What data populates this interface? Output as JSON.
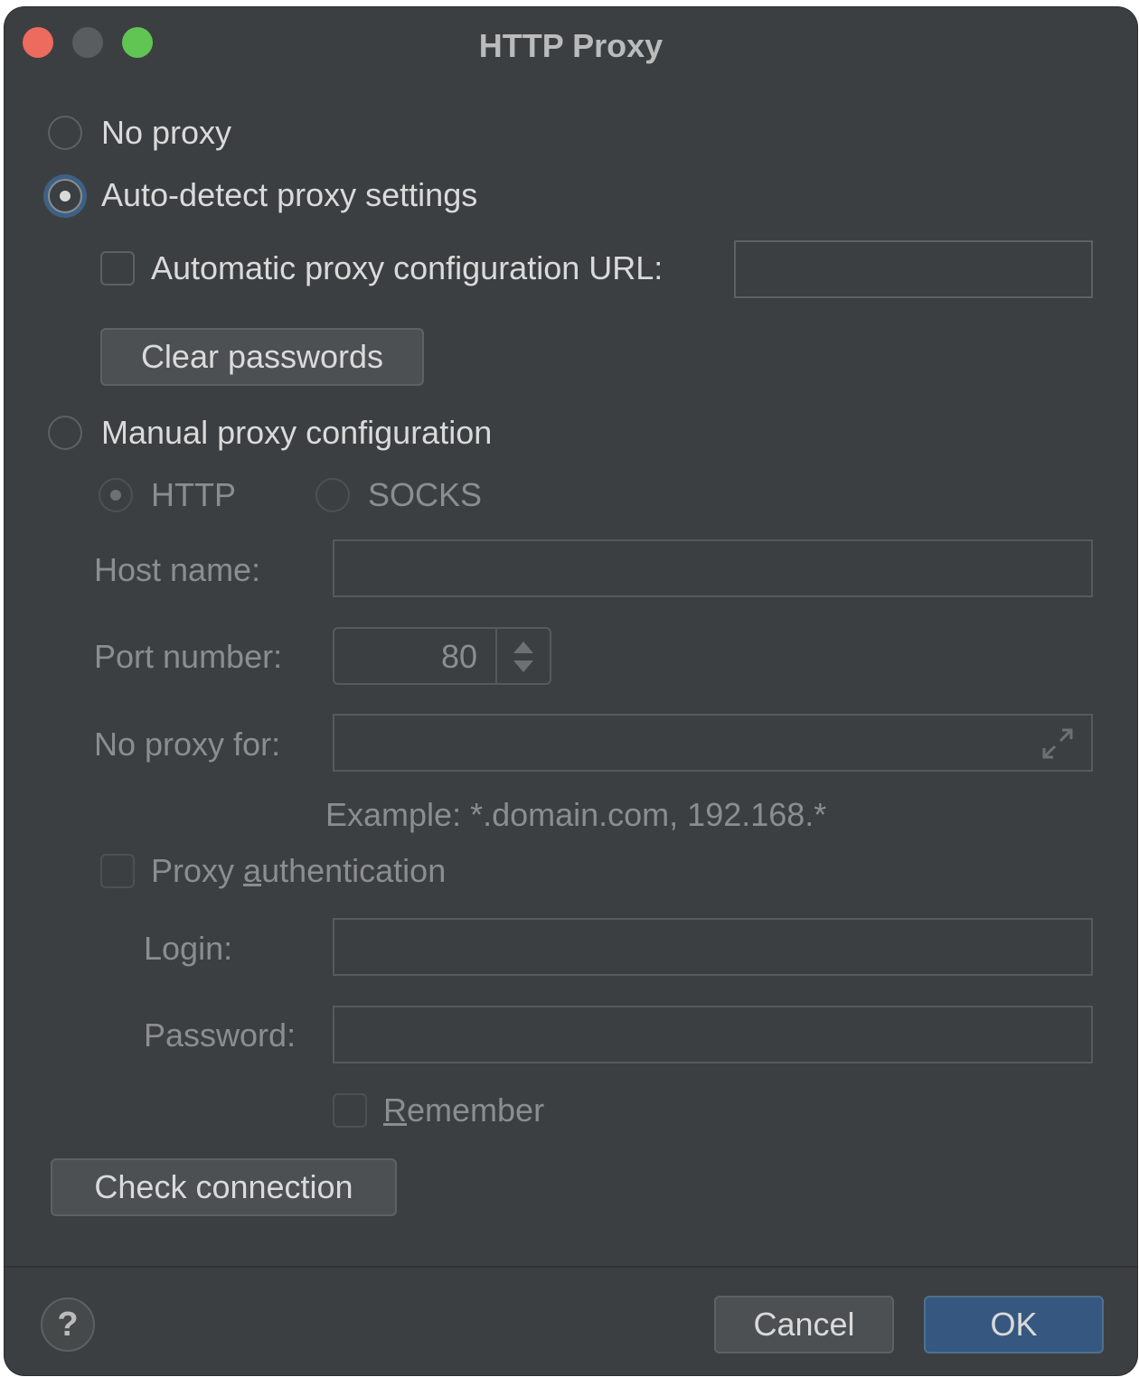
{
  "window": {
    "title": "HTTP Proxy",
    "traffic_lights": {
      "close_color": "#ed6a5e",
      "minimize_color": "#5a5d5f",
      "zoom_color": "#61c554"
    }
  },
  "proxy_mode": {
    "no_proxy_label": "No proxy",
    "auto_detect_label": "Auto-detect proxy settings",
    "manual_label": "Manual proxy configuration",
    "selected": "Auto-detect proxy settings"
  },
  "auto_detect": {
    "pac_url_label": "Automatic proxy configuration URL:",
    "pac_url_checked": false,
    "pac_url_value": "",
    "clear_passwords_label": "Clear passwords"
  },
  "manual": {
    "protocol_http_label": "HTTP",
    "protocol_socks_label": "SOCKS",
    "protocol_selected": "HTTP",
    "host_label": "Host name:",
    "host_value": "",
    "port_label": "Port number:",
    "port_value": "80",
    "no_proxy_for_label": "No proxy for:",
    "no_proxy_for_value": "",
    "example_text": "Example: *.domain.com, 192.168.*",
    "auth_label_pre": "Proxy ",
    "auth_label_mnemonic": "a",
    "auth_label_post": "uthentication",
    "auth_checked": false,
    "login_label": "Login:",
    "login_value": "",
    "password_label": "Password:",
    "password_value": "",
    "remember_label_mnemonic": "R",
    "remember_label_post": "emember",
    "remember_checked": false
  },
  "check_connection_label": "Check connection",
  "footer": {
    "help_label": "?",
    "cancel_label": "Cancel",
    "ok_label": "OK"
  },
  "colors": {
    "background": "#3c3f41",
    "primary_button": "#365880",
    "focus_ring": "#3d6185"
  }
}
